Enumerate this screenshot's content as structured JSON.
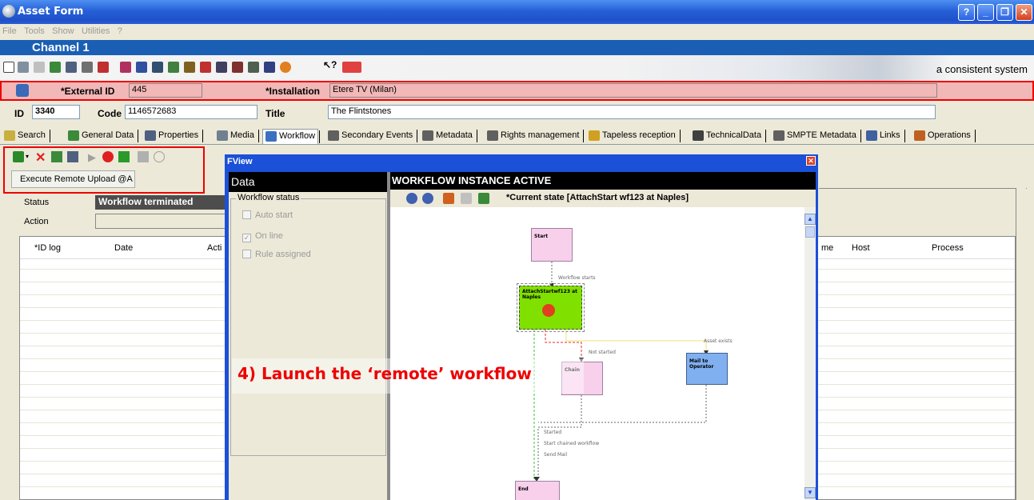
{
  "window": {
    "title": "Asset Form"
  },
  "menu": [
    "File",
    "Tools",
    "Show",
    "Utilities",
    "?"
  ],
  "channel": "Channel 1",
  "slogan": "a consistent system",
  "external": {
    "id_label": "*External ID",
    "id_value": "445",
    "installation_label": "*Installation",
    "installation_value": "Etere TV (Milan)"
  },
  "asset": {
    "id_label": "ID",
    "id_value": "3340",
    "code_label": "Code",
    "code_value": "1146572683",
    "title_label": "Title",
    "title_value": "The Flintstones"
  },
  "tabs": [
    {
      "label": "Search",
      "color": "#c8b040"
    },
    {
      "label": "General Data",
      "color": "#3a8a3a"
    },
    {
      "label": "Properties",
      "color": "#506080"
    },
    {
      "label": "Media",
      "color": "#708090"
    },
    {
      "label": "Workflow",
      "color": "#3a70c0"
    },
    {
      "label": "Secondary Events",
      "color": "#606060"
    },
    {
      "label": "Metadata",
      "color": "#606060"
    },
    {
      "label": "Rights management",
      "color": "#606060"
    },
    {
      "label": "Tapeless reception",
      "color": "#d0a020"
    },
    {
      "label": "TechnicalData",
      "color": "#404040"
    },
    {
      "label": "SMPTE Metadata",
      "color": "#606060"
    },
    {
      "label": "Links",
      "color": "#4060a0"
    },
    {
      "label": "Operations",
      "color": "#c06020"
    }
  ],
  "workflow": {
    "execute_button": "Execute Remote Upload @A",
    "status_label": "Status",
    "status_value": "Workflow terminated",
    "action_label": "Action"
  },
  "log_columns": [
    "*ID log",
    "Date",
    "Acti",
    "me",
    "Host",
    "Process"
  ],
  "fview": {
    "title": "FView",
    "data_header": "Data",
    "status_group": "Workflow status",
    "checkboxes": [
      {
        "label": "Auto start",
        "checked": false
      },
      {
        "label": "On line",
        "checked": true
      },
      {
        "label": "Rule assigned",
        "checked": false
      }
    ],
    "instance_header": "WORKFLOW INSTANCE ACTIVE",
    "current_state": "*Current state [AttachStart wf123 at Naples]",
    "nodes": {
      "start": "Start",
      "attach": "AttachStartwf123 at Naples",
      "chain": "Chain",
      "mail": "Mail to Operator",
      "end": "End"
    },
    "edge_labels": {
      "workflow_starts": "Workflow starts",
      "not_started": "Not started",
      "asset_exists": "Asset exists",
      "started": "Started",
      "start_chained": "Start chained workflow",
      "send_mail": "Send Mail"
    }
  },
  "annotation": "4) Launch the ‘remote’ workflow",
  "colors": {
    "highlight_red": "#e00000",
    "ext_row_bg": "#f2b7b7",
    "node_pink": "#f8d0ec",
    "node_green": "#80e000",
    "node_blue": "#80b0f0",
    "channel_bar": "#1a5fb4"
  }
}
